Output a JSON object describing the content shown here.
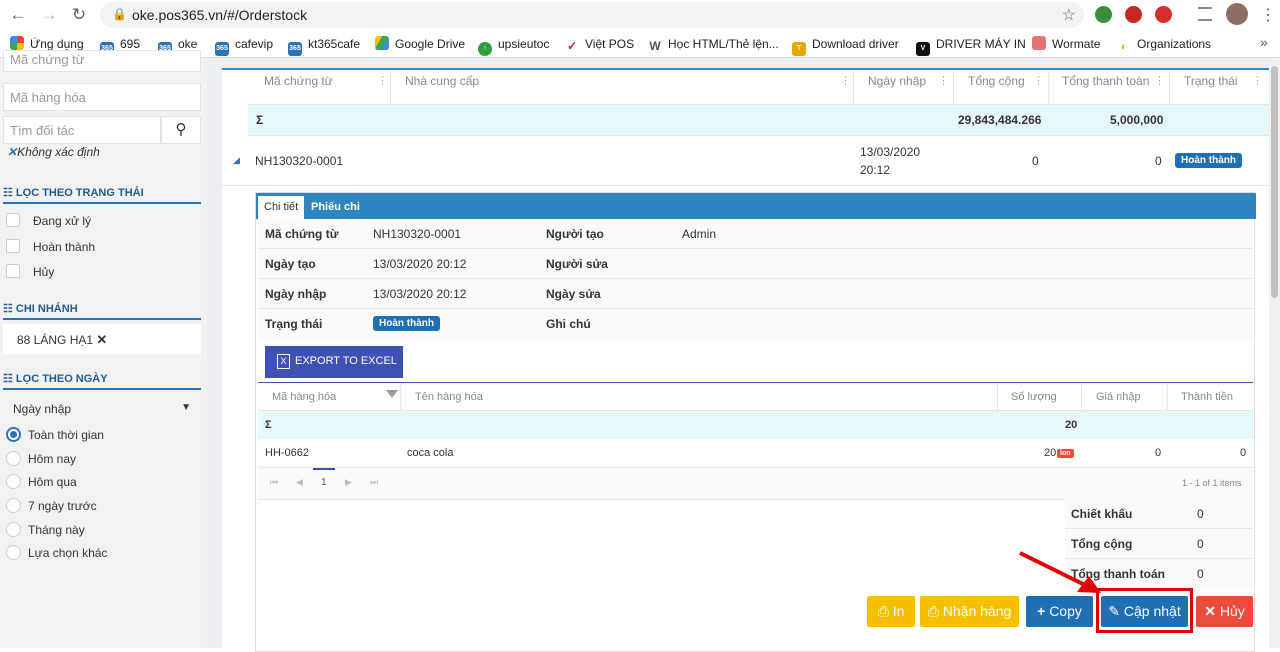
{
  "browser": {
    "url": "oke.pos365.vn/#/Orderstock",
    "bookmarks": [
      "Ứng dụng",
      "695",
      "oke",
      "cafevip",
      "kt365cafe",
      "Google Drive",
      "upsieutoc",
      "Việt POS",
      "Học HTML/Thẻ lện...",
      "Download driver",
      "DRIVER MÁY IN",
      "Wormate",
      "Organizations"
    ]
  },
  "sidebar": {
    "doc_code_placeholder": "Mã chứng từ",
    "product_code_placeholder": "Mã hàng hóa",
    "partner_placeholder": "Tìm đối tác",
    "undefined_label": "Không xác định",
    "status_section": "LỌC THEO TRẠNG THÁI",
    "statuses": [
      "Đang xử lý",
      "Hoàn thành",
      "Hủy"
    ],
    "branch_section": "CHI NHÁNH",
    "branch_tag": "88 LÁNG HẠ1",
    "date_section": "LỌC THEO NGÀY",
    "date_select": "Ngày nhập",
    "date_options": [
      "Toàn thời gian",
      "Hôm nay",
      "Hôm qua",
      "7 ngày trước",
      "Tháng này",
      "Lựa chọn khác"
    ],
    "selected_date_option": 0
  },
  "grid": {
    "columns": [
      "Mã chứng từ",
      "Nhà cung cấp",
      "Ngày nhập",
      "Tổng cộng",
      "Tổng thanh toán",
      "Trạng thái"
    ],
    "sum_symbol": "Σ",
    "sum_total": "29,843,484.266",
    "sum_paid": "5,000,000",
    "row": {
      "code": "NH130320-0001",
      "date_line1": "13/03/2020",
      "date_line2": "20:12",
      "total": "0",
      "paid": "0",
      "status": "Hoàn thành"
    }
  },
  "detail": {
    "tabs": [
      "Chi tiết",
      "Phiếu chi"
    ],
    "info": {
      "doc_code_label": "Mã chứng từ",
      "doc_code": "NH130320-0001",
      "creator_label": "Người tạo",
      "creator": "Admin",
      "created_label": "Ngày tạo",
      "created": "13/03/2020 20:12",
      "editor_label": "Người sửa",
      "import_date_label": "Ngày nhập",
      "import_date": "13/03/2020 20:12",
      "edit_date_label": "Ngày sửa",
      "status_label": "Trạng thái",
      "status": "Hoàn thành",
      "note_label": "Ghi chú"
    },
    "export_label": "EXPORT TO EXCEL",
    "sub_columns": [
      "Mã hàng hóa",
      "Tên hàng hóa",
      "Số lượng",
      "Giá nhập",
      "Thành tiền"
    ],
    "sub_sum_symbol": "Σ",
    "sub_sum_qty": "20",
    "item": {
      "code": "HH-0662",
      "name": "coca cola",
      "qty": "20",
      "unit": "lon",
      "price": "0",
      "amount": "0"
    },
    "pager": {
      "page": "1",
      "info": "1 - 1 of 1 items"
    },
    "summary": [
      {
        "label": "Chiết khấu",
        "value": "0"
      },
      {
        "label": "Tổng cộng",
        "value": "0"
      },
      {
        "label": "Tổng thanh toán",
        "value": "0"
      }
    ]
  },
  "actions": {
    "print": "In",
    "receive": "Nhận hàng",
    "copy": "Copy",
    "update": "Cập nhật",
    "cancel": "Hủy"
  },
  "colors": {
    "accent": "#2b72b7",
    "warning": "#f5c000",
    "danger": "#e74c3c",
    "highlight": "#e00000"
  }
}
